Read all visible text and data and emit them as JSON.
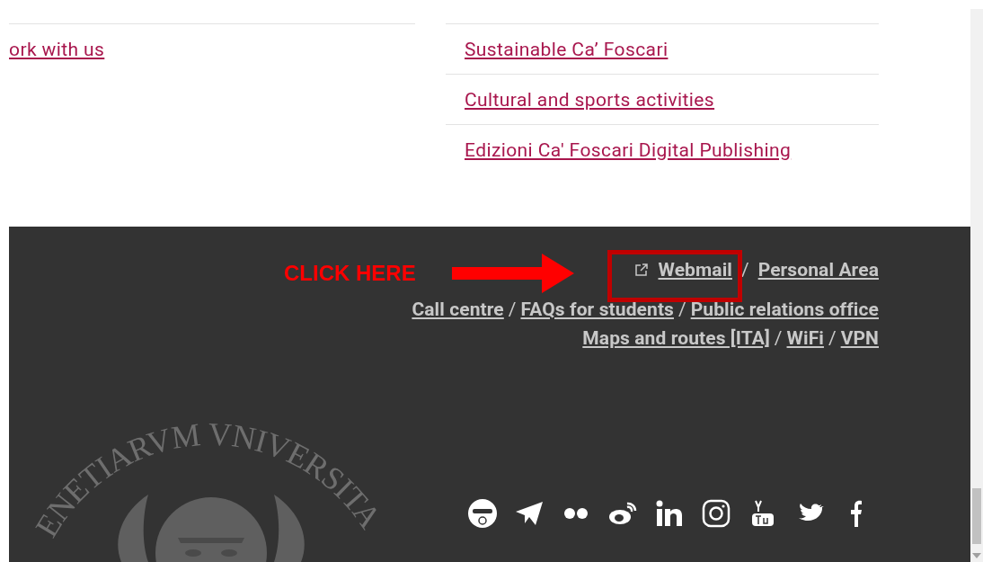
{
  "top_links": {
    "left": [
      {
        "label": "ork with us"
      }
    ],
    "right": [
      {
        "label": "Sustainable Ca’ Foscari"
      },
      {
        "label": "Cultural and sports activities"
      },
      {
        "label": "Edizioni Ca' Foscari Digital Publishing"
      }
    ]
  },
  "footer": {
    "link_rows": [
      [
        {
          "label": "Webmail",
          "external": true
        },
        {
          "label": "Personal Area",
          "separator": "/"
        }
      ],
      [
        {
          "label": "Call centre"
        },
        {
          "label": "FAQs for students",
          "separator": "/"
        },
        {
          "label": "Public relations office",
          "separator": "/"
        }
      ],
      [
        {
          "label": "Maps and routes [ITA]"
        },
        {
          "label": "WiFi",
          "separator": "/"
        },
        {
          "label": "VPN",
          "separator": "/"
        }
      ]
    ],
    "seal_text": "ENETIARVM VNIVERSITA",
    "social_icons": [
      {
        "kind": "mascot"
      },
      {
        "kind": "telegram"
      },
      {
        "kind": "flickr"
      },
      {
        "kind": "weibo"
      },
      {
        "kind": "linkedin"
      },
      {
        "kind": "instagram"
      },
      {
        "kind": "youtube"
      },
      {
        "kind": "twitter"
      },
      {
        "kind": "facebook"
      }
    ]
  },
  "annotation": {
    "label": "CLICK HERE"
  }
}
